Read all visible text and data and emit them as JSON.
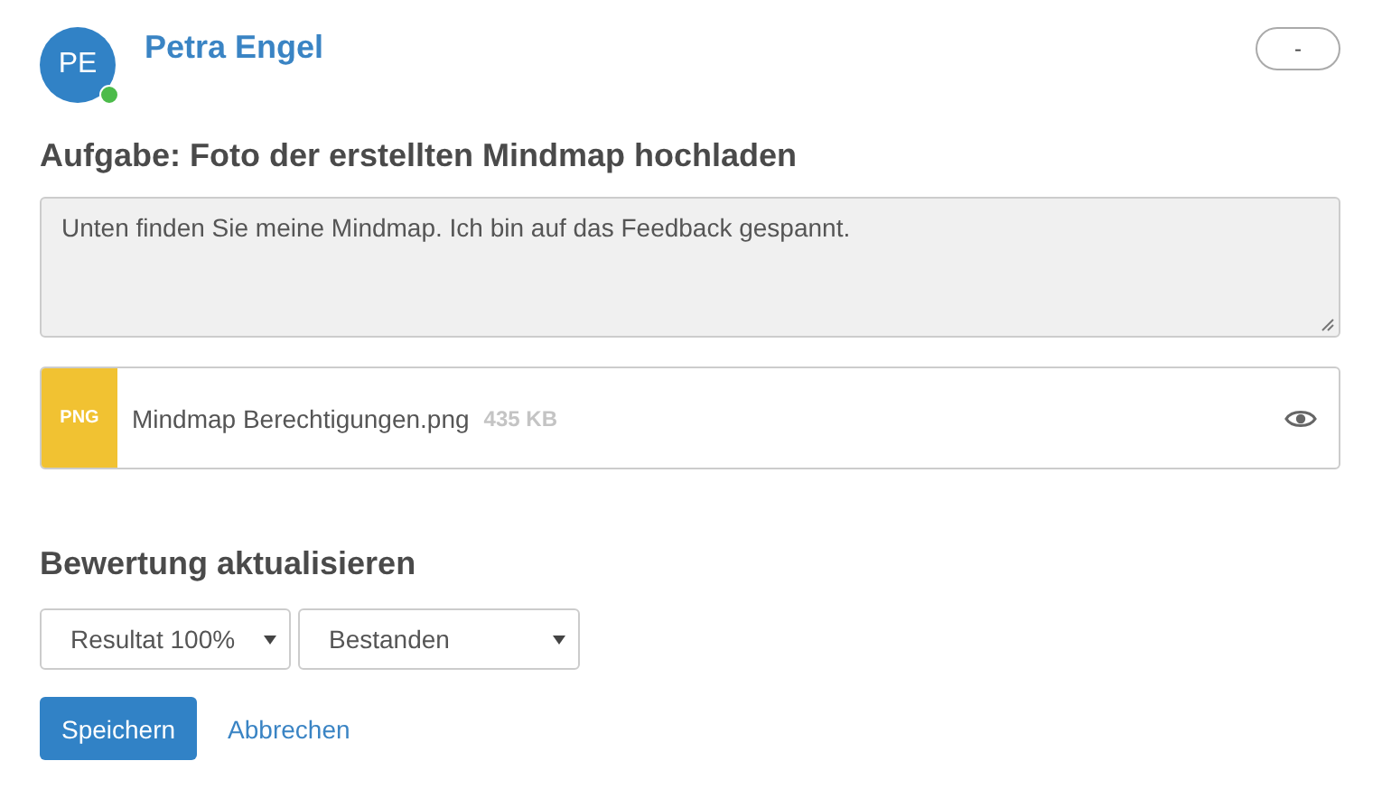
{
  "user": {
    "initials": "PE",
    "name": "Petra Engel",
    "online": true
  },
  "menu_button": {
    "label": "-"
  },
  "task": {
    "title": "Aufgabe: Foto der erstellten Mindmap hochladen"
  },
  "comment": {
    "value": "Unten finden Sie meine Mindmap. Ich bin auf das Feedback gespannt."
  },
  "attachment": {
    "type": "PNG",
    "filename": "Mindmap Berechtigungen.png",
    "size": "435 KB"
  },
  "rating": {
    "title": "Bewertung aktualisieren",
    "selects": [
      {
        "value": "Resultat 100%"
      },
      {
        "value": "Bestanden"
      }
    ]
  },
  "buttons": [
    {
      "kind": "primary",
      "label": "Speichern"
    },
    {
      "kind": "link",
      "label": "Abbrechen"
    }
  ]
}
